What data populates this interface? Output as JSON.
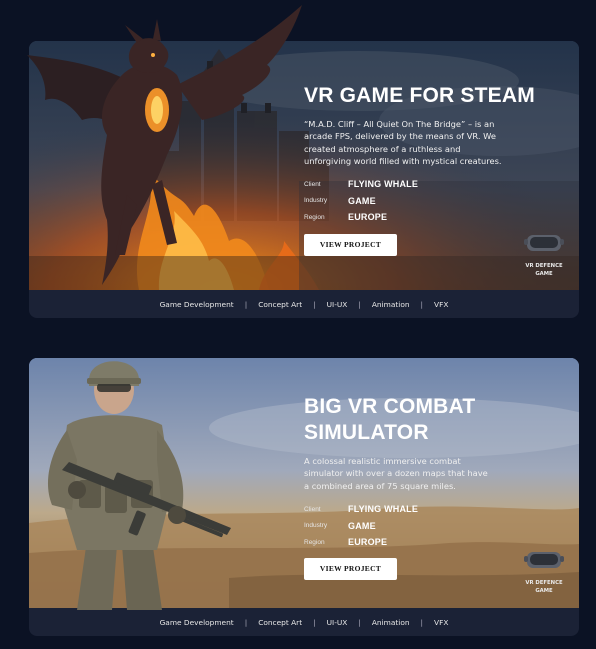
{
  "projects": [
    {
      "title": "VR GAME FOR STEAM",
      "description": "“M.A.D. Cliff – All Quiet On The Bridge” – is an arcade FPS, delivered by the means of VR. We created atmosphere of a ruthless and unforgiving world filled with mystical creatures.",
      "client_label": "Client",
      "client": "FLYING WHALE",
      "industry_label": "Industry",
      "industry": "GAME",
      "region_label": "Region",
      "region": "EUROPE",
      "button": "VIEW PROJECT",
      "badge": [
        "VR DEFENCE",
        "GAME"
      ],
      "tags": [
        "Game Development",
        "Concept Art",
        "UI-UX",
        "Animation",
        "VFX"
      ]
    },
    {
      "title_lines": [
        "BIG VR COMBAT",
        "SIMULATOR"
      ],
      "description": "A colossal realistic immersive combat simulator with over a dozen maps that have a combined area of 75 square miles.",
      "client_label": "Client",
      "client": "FLYING WHALE",
      "industry_label": "Industry",
      "industry": "GAME",
      "region_label": "Region",
      "region": "EUROPE",
      "button": "VIEW PROJECT",
      "badge": [
        "VR DEFENCE",
        "GAME"
      ],
      "tags": [
        "Game Development",
        "Concept Art",
        "UI-UX",
        "Animation",
        "VFX"
      ]
    }
  ],
  "colors": {
    "page_background": "#0b1224",
    "card_footer": "#1b2236",
    "button_background": "#ffffff",
    "button_text": "#111111"
  },
  "icons": [
    "vr-headset-icon"
  ]
}
